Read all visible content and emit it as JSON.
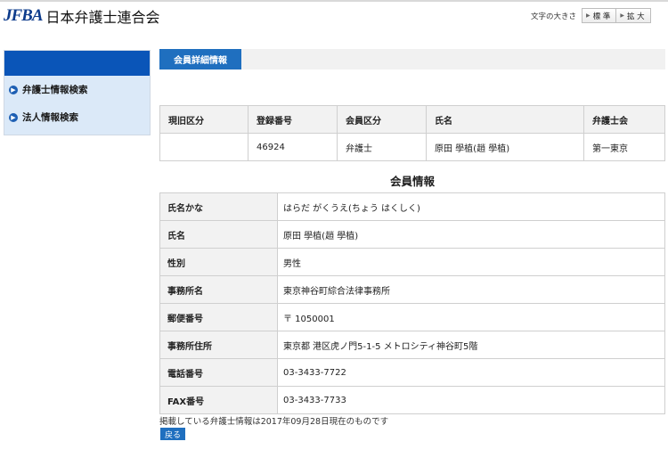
{
  "header": {
    "logo_mark": "JFBA",
    "logo_text": "日本弁護士連合会",
    "font_size_label": "文字の大きさ",
    "font_size_options": [
      "標 準",
      "拡 大"
    ]
  },
  "sidebar": {
    "items": [
      {
        "label": "弁護士情報検索"
      },
      {
        "label": "法人情報検索"
      }
    ]
  },
  "section": {
    "tab_label": "会員詳細情報"
  },
  "summary_table": {
    "headers": [
      "現旧区分",
      "登録番号",
      "会員区分",
      "氏名",
      "弁護士会"
    ],
    "row": [
      "",
      "46924",
      "弁護士",
      "原田 學植(趙 學植)",
      "第一東京"
    ]
  },
  "member_info": {
    "title": "会員情報",
    "rows": [
      {
        "label": "氏名かな",
        "value": "はらだ がくうえ(ちょう はくしく)"
      },
      {
        "label": "氏名",
        "value": "原田 學植(趙 學植)"
      },
      {
        "label": "性別",
        "value": "男性"
      },
      {
        "label": "事務所名",
        "value": "東京神谷町綜合法律事務所"
      },
      {
        "label": "郵便番号",
        "value": "〒 1050001"
      },
      {
        "label": "事務所住所",
        "value": "東京都 港区虎ノ門5-1-5 メトロシティ神谷町5階"
      },
      {
        "label": "電話番号",
        "value": "03-3433-7722"
      },
      {
        "label": "FAX番号",
        "value": "03-3433-7733"
      }
    ]
  },
  "footer": {
    "note": "掲載している弁護士情報は2017年09月28日現在のものです",
    "back_label": "戻る"
  },
  "colors": {
    "brand_blue": "#0a55b8",
    "tab_blue": "#1f6fbf",
    "sidebar_bg": "#dbe9f8",
    "table_header_bg": "#f2f2f2"
  }
}
